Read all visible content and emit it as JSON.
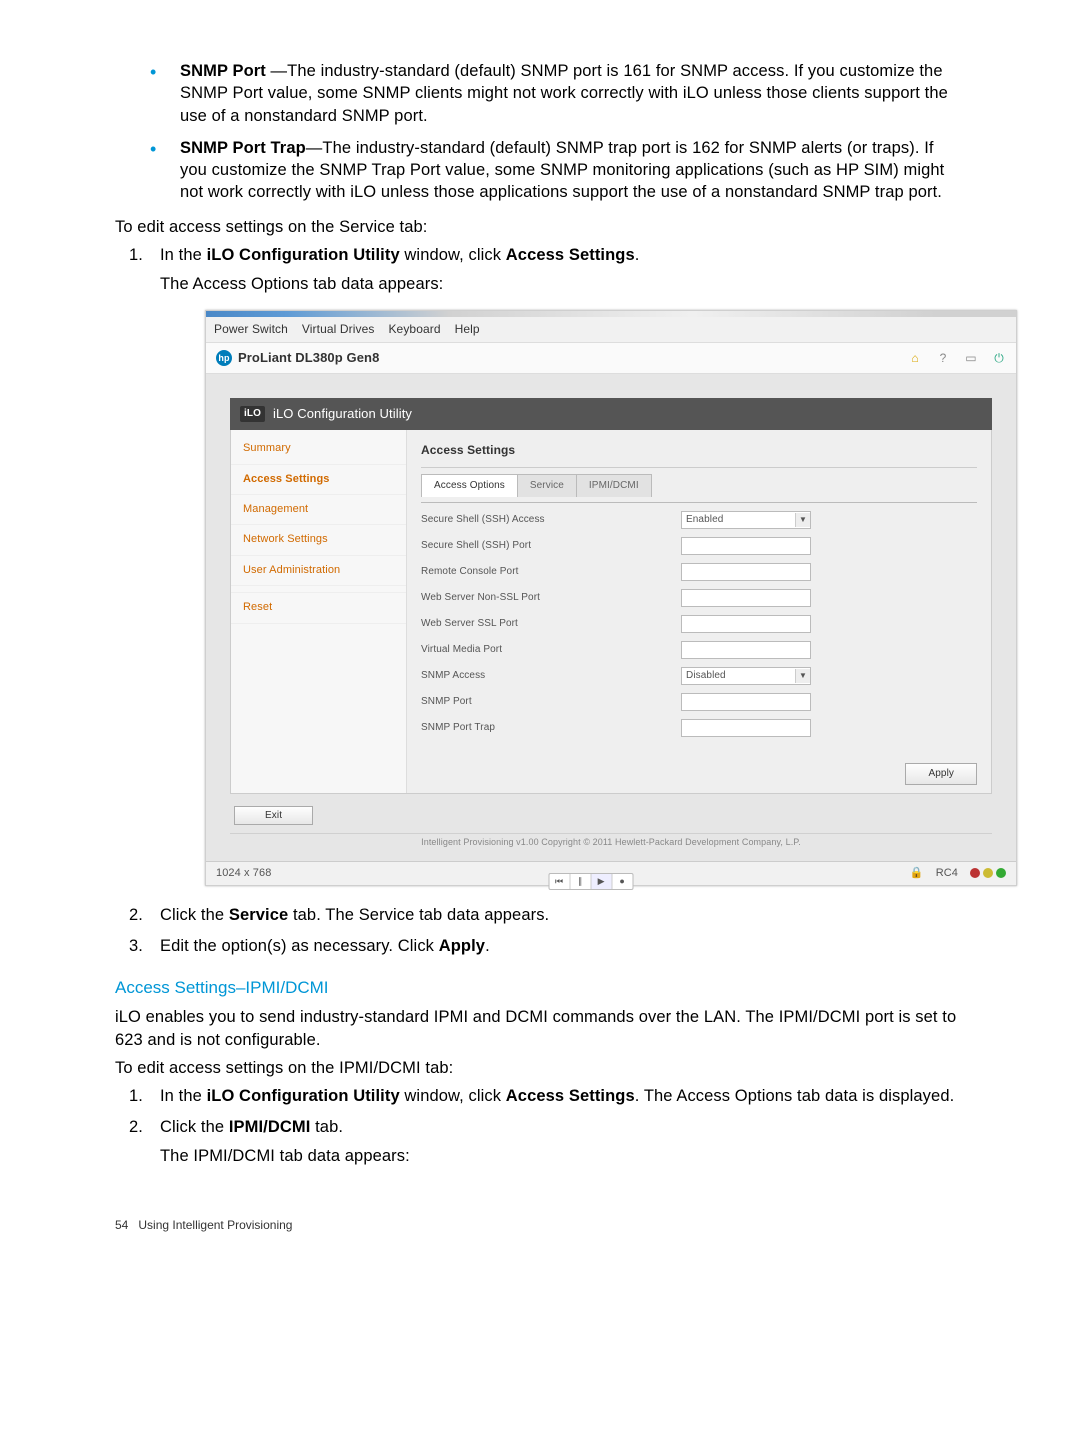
{
  "bullets": [
    {
      "term": "SNMP Port",
      "sep": " —",
      "text": "The industry-standard (default) SNMP port is 161 for SNMP access. If you customize the SNMP Port value, some SNMP clients might not work correctly with iLO unless those clients support the use of a nonstandard SNMP port."
    },
    {
      "term": "SNMP Port Trap",
      "sep": "—",
      "text": "The industry-standard (default) SNMP trap port is 162 for SNMP alerts (or traps). If you customize the SNMP Trap Port value, some SNMP monitoring applications (such as HP SIM) might not work correctly with iLO unless those applications support the use of a nonstandard SNMP trap port."
    }
  ],
  "intro_text": "To edit access settings on the Service tab:",
  "steps1": {
    "s1_pre": "In the ",
    "s1_b1": "iLO Configuration Utility",
    "s1_mid": " window, click ",
    "s1_b2": "Access Settings",
    "s1_post": ".",
    "s1_sub": "The Access Options tab data appears:"
  },
  "steps2": {
    "s2_pre": "Click the ",
    "s2_b": "Service",
    "s2_post": "  tab. The Service tab data appears.",
    "s3_pre": "Edit the option(s) as necessary. Click ",
    "s3_b": "Apply",
    "s3_post": "."
  },
  "section_heading": "Access Settings–IPMI/DCMI",
  "ipmi": {
    "p1": "iLO enables you to send industry-standard IPMI and DCMI commands over the LAN. The IPMI/DCMI port is set to 623 and is not configurable.",
    "p2": "To edit access settings on the IPMI/DCMI tab:",
    "s1_pre": "In the ",
    "s1_b1": "iLO Configuration Utility",
    "s1_mid": " window, click ",
    "s1_b2": "Access Settings",
    "s1_post": ". The Access Options tab data is displayed.",
    "s2_pre": "Click the ",
    "s2_b": "IPMI/DCMI",
    "s2_post": " tab.",
    "s2_sub": "The IPMI/DCMI tab data appears:"
  },
  "footer": {
    "page_num": "54",
    "title": "Using Intelligent Provisioning"
  },
  "screenshot": {
    "menubar": [
      "Power Switch",
      "Virtual Drives",
      "Keyboard",
      "Help"
    ],
    "titlebar": "ProLiant DL380p Gen8",
    "util_title": "iLO Configuration Utility",
    "sidebar": [
      "Summary",
      "Access Settings",
      "Management",
      "Network Settings",
      "User Administration",
      "Reset"
    ],
    "content_title": "Access Settings",
    "tabs": [
      "Access Options",
      "Service",
      "IPMI/DCMI"
    ],
    "form": {
      "ssh_access": {
        "label": "Secure Shell (SSH) Access",
        "value": "Enabled",
        "type": "select"
      },
      "ssh_port": {
        "label": "Secure Shell (SSH) Port",
        "value": "",
        "type": "text"
      },
      "remote_console": {
        "label": "Remote Console Port",
        "value": "",
        "type": "text"
      },
      "web_nonssl": {
        "label": "Web Server Non-SSL Port",
        "value": "",
        "type": "text"
      },
      "web_ssl": {
        "label": "Web Server SSL Port",
        "value": "",
        "type": "text"
      },
      "virtual_media": {
        "label": "Virtual Media Port",
        "value": "",
        "type": "text"
      },
      "snmp_access": {
        "label": "SNMP Access",
        "value": "Disabled",
        "type": "select"
      },
      "snmp_port": {
        "label": "SNMP Port",
        "value": "",
        "type": "text"
      },
      "snmp_trap": {
        "label": "SNMP Port Trap",
        "value": "",
        "type": "text"
      }
    },
    "apply_btn": "Apply",
    "exit_btn": "Exit",
    "footer_text": "Intelligent Provisioning v1.00 Copyright © 2011 Hewlett-Packard Development Company, L.P.",
    "statusbar": {
      "res": "1024 x 768",
      "rc": "RC4"
    }
  }
}
